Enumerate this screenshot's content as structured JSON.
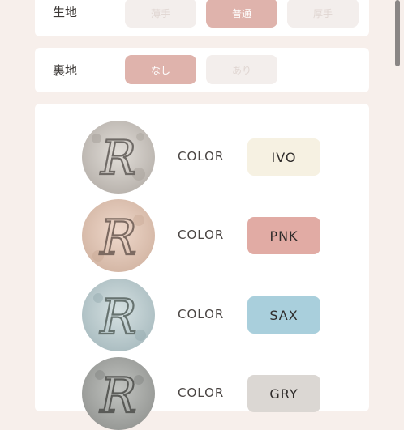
{
  "fabric": {
    "label": "生地",
    "options": [
      {
        "label": "薄手",
        "selected": false
      },
      {
        "label": "普通",
        "selected": true
      },
      {
        "label": "厚手",
        "selected": false
      }
    ]
  },
  "lining": {
    "label": "裏地",
    "options": [
      {
        "label": "なし",
        "selected": true
      },
      {
        "label": "あり",
        "selected": false
      }
    ]
  },
  "colors": {
    "items": [
      {
        "label": "COLOR",
        "code": "IVO",
        "chip_color": "#f6f1e2",
        "swatch_bg": "#c9c4bf"
      },
      {
        "label": "COLOR",
        "code": "PNK",
        "chip_color": "#e1aba4",
        "swatch_bg": "#e2c6b6"
      },
      {
        "label": "COLOR",
        "code": "SAX",
        "chip_color": "#a9cfdc",
        "swatch_bg": "#b9cbcf"
      },
      {
        "label": "COLOR",
        "code": "GRY",
        "chip_color": "#dbd7d3",
        "swatch_bg": "#a9aba8"
      }
    ]
  },
  "theme": {
    "accent": "#dfb3ac",
    "page_bg": "#f7efeb"
  }
}
